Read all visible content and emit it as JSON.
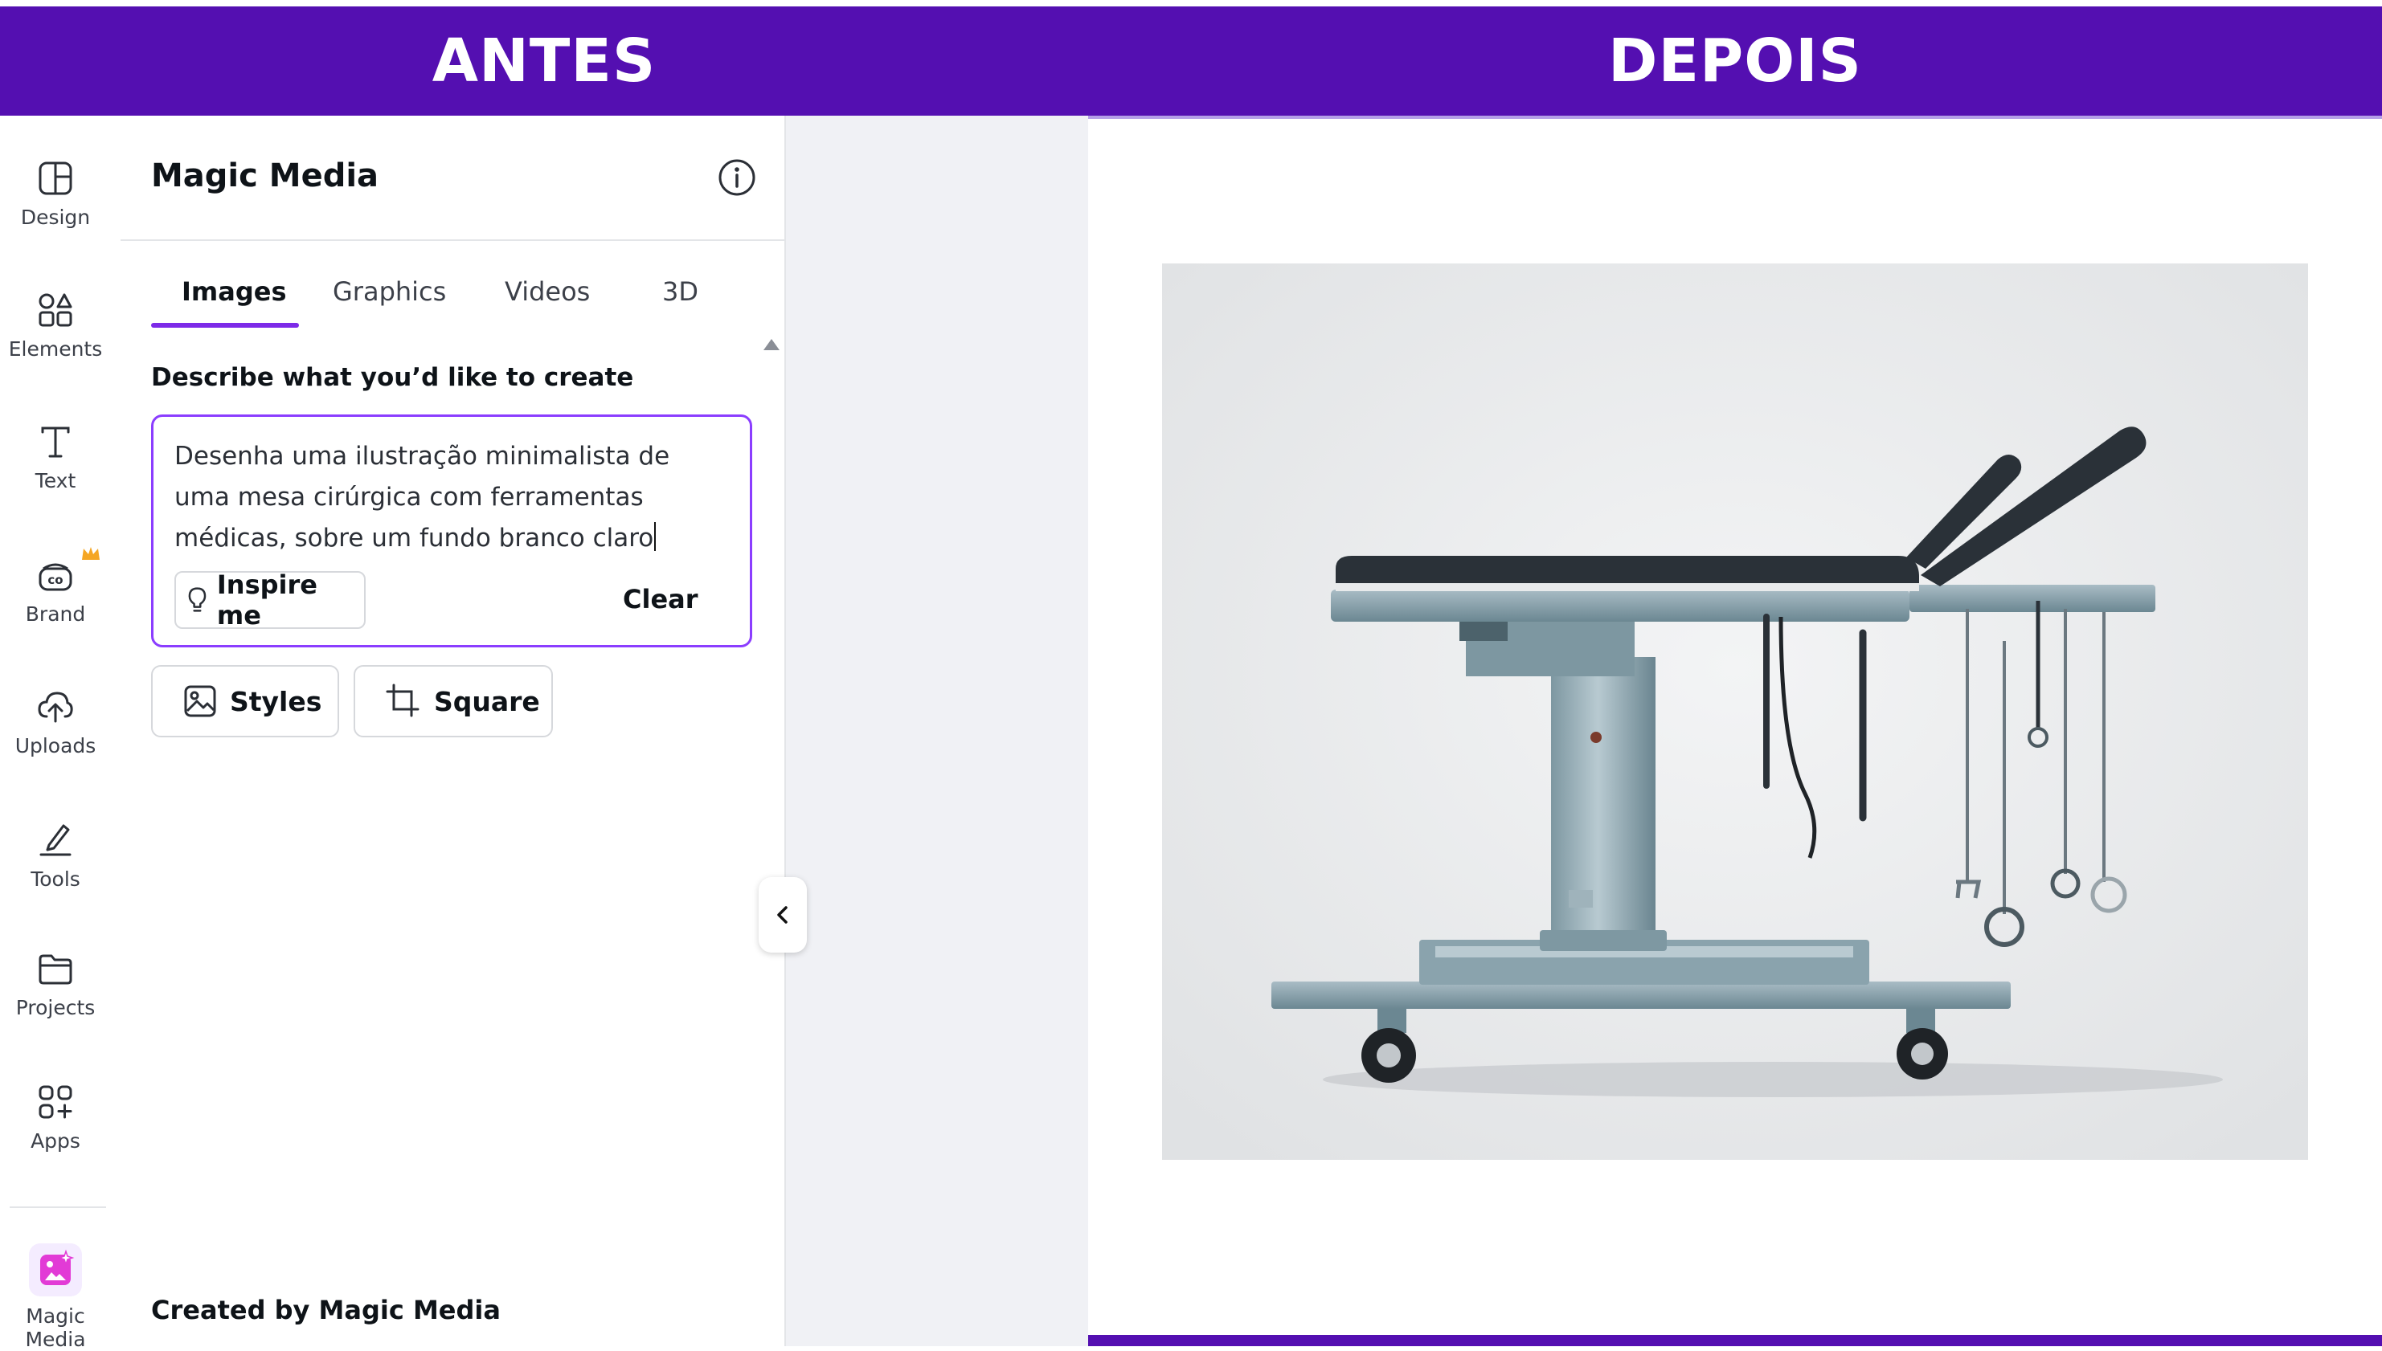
{
  "banners": {
    "left": "ANTES",
    "right": "DEPOIS"
  },
  "rail": {
    "items": [
      {
        "label": "Design",
        "icon": "design-icon"
      },
      {
        "label": "Elements",
        "icon": "elements-icon"
      },
      {
        "label": "Text",
        "icon": "text-icon"
      },
      {
        "label": "Brand",
        "icon": "brand-icon"
      },
      {
        "label": "Uploads",
        "icon": "uploads-icon"
      },
      {
        "label": "Tools",
        "icon": "tools-icon"
      },
      {
        "label": "Projects",
        "icon": "projects-icon"
      },
      {
        "label": "Apps",
        "icon": "apps-icon"
      },
      {
        "label": "Magic Media",
        "icon": "magic-media-icon"
      }
    ]
  },
  "panel": {
    "title": "Magic Media",
    "tabs": [
      {
        "label": "Images"
      },
      {
        "label": "Graphics"
      },
      {
        "label": "Videos"
      },
      {
        "label": "3D"
      }
    ],
    "describe_label": "Describe what you’d like to create",
    "prompt": {
      "line1": "Desenha uma ilustração minimalista de",
      "line2": "uma mesa cirúrgica com ferramentas",
      "line3": "médicas, sobre um fundo branco claro"
    },
    "inspire_label": "Inspire me",
    "clear_label": "Clear",
    "styles_label": "Styles",
    "square_label": "Square",
    "footer_label": "Created by Magic Media"
  },
  "colors": {
    "banner": "#540fb1",
    "accent": "#8b3dff",
    "canvas_bg": "#f0f1f5"
  }
}
